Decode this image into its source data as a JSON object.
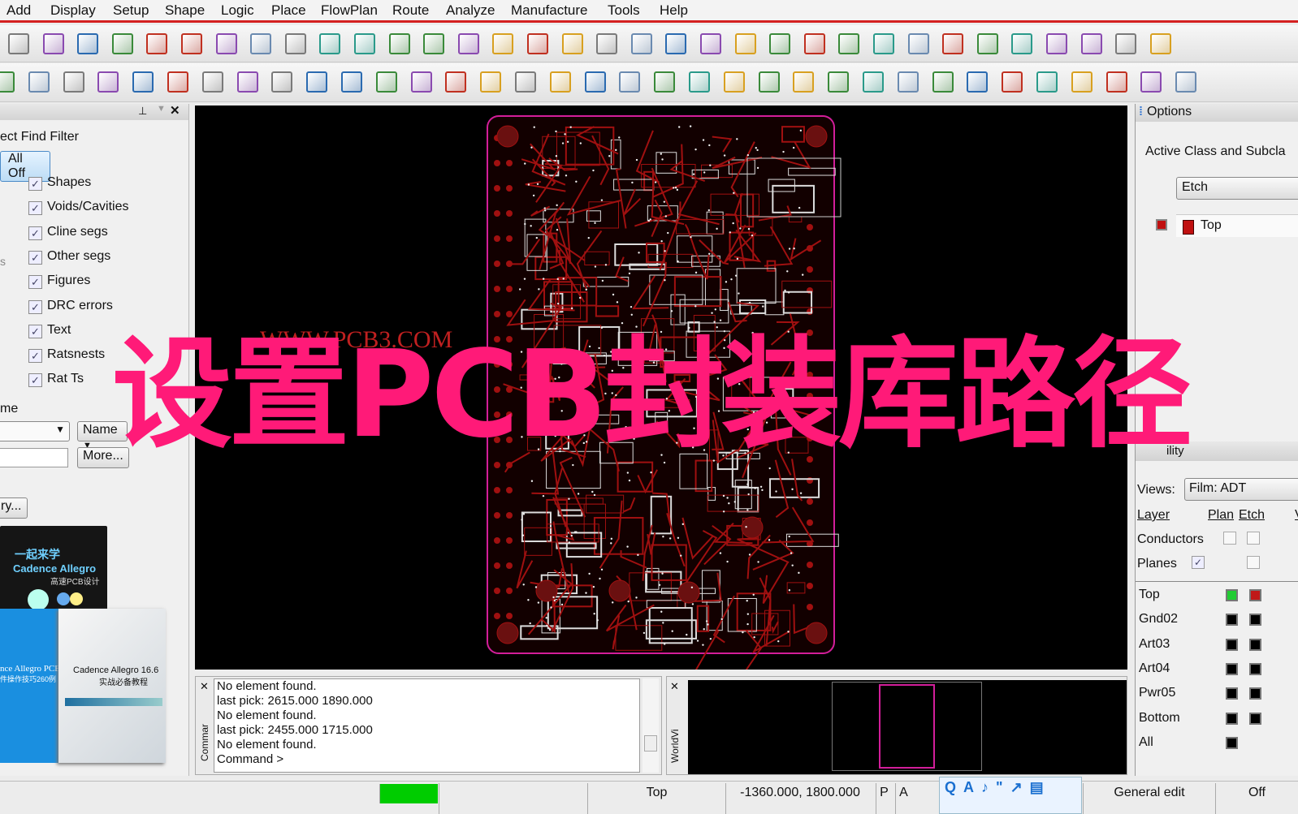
{
  "menu": [
    "Add",
    "Display",
    "Setup",
    "Shape",
    "Logic",
    "Place",
    "FlowPlan",
    "Route",
    "Analyze",
    "Manufacture",
    "Tools",
    "Help"
  ],
  "toolbar1": [
    "move-icon",
    "copy-icon",
    "delete-icon",
    "undo-icon",
    "redo-down-icon",
    "redo-icon",
    "add-connect-icon",
    "pin-icon",
    "grid-icon",
    "grid2-icon",
    "zoom-fit-icon",
    "zoom-icon",
    "zoom-in-icon",
    "zoom-out-icon",
    "zoom-prev-icon",
    "zoom-world-icon",
    "refresh-icon",
    "3d-view-icon",
    "flip-icon",
    "grid-dots-icon",
    "color-icon",
    "layers-icon",
    "stack-icon",
    "cm-icon",
    "dfa-icon",
    "globe-icon",
    "info-icon",
    "report-icon",
    "numbers-icon",
    "highlight-icon",
    "sun-icon",
    "shadow-icon",
    "bars-icon",
    "brand-logo-icon"
  ],
  "toolbar2": [
    "shape-green-icon",
    "shape-add-icon",
    "shape-gray-icon",
    "shape-void-icon",
    "line-icon",
    "rect-icon",
    "circle-icon",
    "select-icon",
    "poly-icon",
    "arc-icon",
    "square-icon",
    "oval-icon",
    "frame-icon",
    "flag-icon",
    "component-icon",
    "dimension-icon",
    "measure-icon",
    "odb-icon",
    "book-icon",
    "tune-icon",
    "camera-icon",
    "rename-icon",
    "panel-icon",
    "grid-pattern-icon",
    "net-icon",
    "array-icon",
    "wave-icon",
    "doc1-icon",
    "doc2-icon",
    "doc3-icon",
    "doc4-icon",
    "doc5-icon",
    "copy2-icon",
    "mail-icon",
    "doc6-icon"
  ],
  "find_filter": {
    "title": "ect Find Filter",
    "all_off": "All Off",
    "items": [
      {
        "label": "Shapes",
        "checked": true
      },
      {
        "label": "Voids/Cavities",
        "checked": true
      },
      {
        "label": "Cline segs",
        "checked": true
      },
      {
        "label": "Other segs",
        "checked": true
      },
      {
        "label": "Figures",
        "checked": true
      },
      {
        "label": "DRC errors",
        "checked": true
      },
      {
        "label": "Text",
        "checked": true
      },
      {
        "label": "Ratsnests",
        "checked": true
      },
      {
        "label": "Rat Ts",
        "checked": true
      }
    ],
    "name_label": "me",
    "name_select": "Name",
    "more": "More...",
    "query": "ry...",
    "side_s": "s",
    "check": "✓"
  },
  "books": {
    "book1_title": "一起来学",
    "book1_sub": "Cadence Allegro",
    "book1_cn": "高速PCB设计",
    "book2_title": "nce Allegro PCB",
    "book2_cn": "件操作技巧260例",
    "book3_title": "Cadence Allegro 16.6",
    "book3_cn": "实战必备教程"
  },
  "canvas": {
    "watermark": "WWW.PCB3.COM",
    "overlay": "设置PCB封装库路径"
  },
  "command": {
    "lines": [
      "No element found.",
      "last pick:  2615.000 1890.000",
      "No element found.",
      "last pick:  2455.000 1715.000",
      "No element found.",
      "Command >"
    ],
    "tab_label": "Commar",
    "wv_label": "WorldVi"
  },
  "options": {
    "title": "Options",
    "active_label": "Active Class and Subcla",
    "class": "Etch",
    "subclass": "Top",
    "subclass_color": "#c01010"
  },
  "visibility": {
    "title": "ility",
    "views_label": "Views:",
    "views": "Film: ADT",
    "col_layer": "Layer",
    "col_plan": "Plan",
    "col_etch": "Etch",
    "col_v": "V",
    "conductors": "Conductors",
    "planes": "Planes",
    "layers": [
      "Top",
      "Gnd02",
      "Art03",
      "Art04",
      "Pwr05",
      "Bottom",
      "All"
    ],
    "top_plan_color": "#22cc33",
    "top_etch_color": "#c01818"
  },
  "status": {
    "layer": "Top",
    "coords": "-1360.000, 1800.000",
    "p": "P",
    "a": "A",
    "mode": "General edit",
    "off": "Off",
    "indicator_color": "#00cc00"
  },
  "colors": {
    "board_outline": "#d21e9a",
    "copper": "#a01010",
    "overlay": "#ff1a78"
  }
}
